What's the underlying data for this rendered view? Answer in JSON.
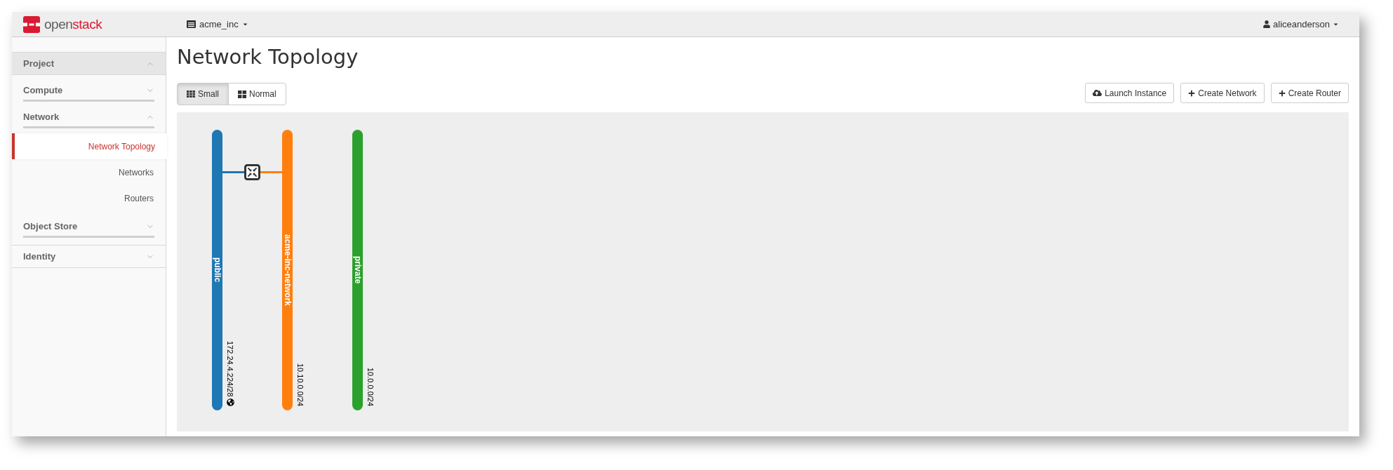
{
  "topbar": {
    "logo": {
      "part_1": "open",
      "part_2": "stack"
    },
    "project_menu": "acme_inc",
    "user_menu": "aliceanderson"
  },
  "sidebar": {
    "items": [
      {
        "label": "Project",
        "kind": "panel",
        "expanded": true,
        "children": [
          {
            "label": "Compute",
            "kind": "group",
            "expanded": false
          },
          {
            "label": "Network",
            "kind": "group",
            "expanded": true,
            "children": [
              {
                "label": "Network Topology",
                "selected": true
              },
              {
                "label": "Networks",
                "selected": false
              },
              {
                "label": "Routers",
                "selected": false
              }
            ]
          },
          {
            "label": "Object Store",
            "kind": "group",
            "expanded": false
          }
        ]
      },
      {
        "label": "Identity",
        "kind": "panel",
        "expanded": false
      }
    ]
  },
  "main": {
    "title": "Network Topology",
    "view_toggle": [
      {
        "label": "Small",
        "kind": "small",
        "selected": true
      },
      {
        "label": "Normal",
        "kind": "normal",
        "selected": false
      }
    ],
    "actions": [
      {
        "label": "Launch Instance",
        "kind": "launch"
      },
      {
        "label": "Create Network",
        "kind": "create"
      },
      {
        "label": "Create Router",
        "kind": "create"
      }
    ],
    "canvas": {
      "networks": [
        {
          "name": "public",
          "cidr": "172.24.4.224/28",
          "color": "#1f77b4",
          "external": true,
          "router_link": true
        },
        {
          "name": "acme-inc-network",
          "cidr": "10.10.0.0/24",
          "color": "#ff7f0e",
          "external": false,
          "router_link": true
        },
        {
          "name": "private",
          "cidr": "10.0.0.0/24",
          "color": "#2ca02c",
          "external": false,
          "router_link": false
        }
      ]
    }
  }
}
